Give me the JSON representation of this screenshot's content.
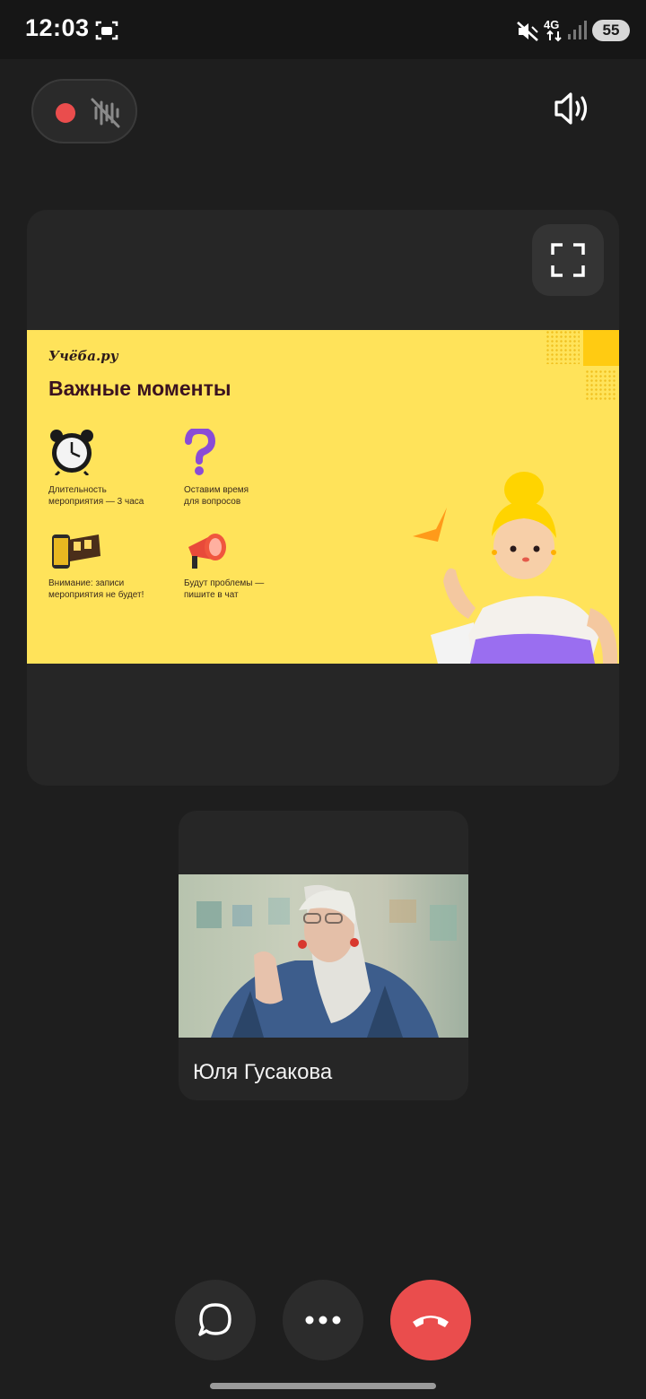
{
  "status_bar": {
    "time": "12:03",
    "network": "4G",
    "battery": "55"
  },
  "call": {
    "recording_indicator_color": "#ea4d4d",
    "microphone": "muted",
    "end_call_color": "#ea4d4d"
  },
  "slide": {
    "logo": "Учёба.ру",
    "title": "Важные моменты",
    "items": [
      {
        "icon": "alarm-clock-icon",
        "text_line1": "Длительность",
        "text_line2": "мероприятия — 3 часа"
      },
      {
        "icon": "question-mark-icon",
        "text_line1": "Оставим время",
        "text_line2": "для вопросов"
      },
      {
        "icon": "film-roll-icon",
        "text_line1": "Внимание: записи",
        "text_line2": "мероприятия не будет!"
      },
      {
        "icon": "megaphone-icon",
        "text_line1": "Будут проблемы —",
        "text_line2": "пишите в чат"
      }
    ],
    "background_color": "#ffe35a"
  },
  "participant": {
    "name": "Юля Гусакова"
  }
}
